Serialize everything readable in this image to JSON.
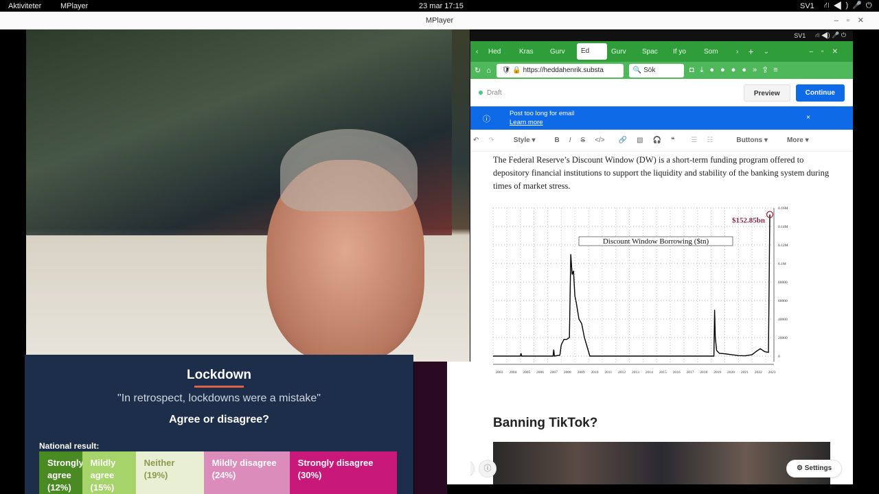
{
  "system": {
    "activities": "Aktiviteter",
    "app": "MPlayer",
    "clock": "23 mar  17:15",
    "lang": "SV1"
  },
  "window": {
    "title": "MPlayer"
  },
  "poll": {
    "title": "Lockdown",
    "quote": "\"In retrospect, lockdowns were a mistake\"",
    "question": "Agree or disagree?",
    "national_label": "National result:",
    "options": [
      {
        "label": "Strongly agree",
        "pct": "(12%)",
        "value": 12,
        "color": "#4a8a22"
      },
      {
        "label": "Mildly agree",
        "pct": "(15%)",
        "value": 15,
        "color": "#a6d46a"
      },
      {
        "label": "Neither",
        "pct": "(19%)",
        "value": 19,
        "color": "#e9efd2"
      },
      {
        "label": "Mildly disagree",
        "pct": "(24%)",
        "value": 24,
        "color": "#dc8cba"
      },
      {
        "label": "Strongly disagree",
        "pct": "(30%)",
        "value": 30,
        "color": "#c8197a"
      }
    ]
  },
  "browser": {
    "tabs": [
      "Hed",
      "Kras",
      "Gurv",
      "Ed",
      "Gurv",
      "Spac",
      "If yo",
      "Som"
    ],
    "active_tab": 3,
    "url": "https://heddahenrik.substa",
    "search_placeholder": "Sök",
    "lang": "SV1"
  },
  "editor": {
    "status": "Draft",
    "preview": "Preview",
    "continue": "Continue",
    "banner_text": "Post too long for email",
    "banner_link": "Learn more",
    "toolbar": {
      "style": "Style",
      "buttons": "Buttons",
      "more": "More"
    },
    "paragraph": "The Federal Reserve’s Discount Window (DW) is a short-term funding program offered to depository financial institutions to support the liquidity and stability of the banking system during times of market stress.",
    "heading": "Banning TikTok?",
    "settings": "Settings",
    "accent": "#0f6ae8"
  },
  "chart_data": {
    "type": "line",
    "title": "Discount Window Borrowing ($tn)",
    "annotation": "$152.85bn",
    "x_ticks": [
      "2003",
      "2004",
      "2005",
      "2006",
      "2007",
      "2008",
      "2009",
      "2010",
      "2011",
      "2012",
      "2013",
      "2014",
      "2015",
      "2016",
      "2017",
      "2018",
      "2019",
      "2020",
      "2021",
      "2022",
      "2023"
    ],
    "y_ticks": [
      "0",
      "20000",
      "40000",
      "60000",
      "80000",
      "0.1M",
      "0.12M",
      "0.14M",
      "0.16M"
    ],
    "ylim": [
      0,
      160000
    ],
    "xlim": [
      2003,
      2023.4
    ],
    "grid": true,
    "x": [
      2003,
      2005,
      2005.05,
      2005.1,
      2007.4,
      2007.45,
      2007.5,
      2007.9,
      2008.0,
      2008.2,
      2008.4,
      2008.6,
      2008.7,
      2008.8,
      2008.9,
      2009.0,
      2009.1,
      2009.3,
      2009.5,
      2009.7,
      2009.9,
      2010.1,
      2010.3,
      2019.2,
      2019.25,
      2019.3,
      2019.4,
      2019.6,
      2020,
      2020.5,
      2021,
      2021.5,
      2022,
      2022.3,
      2022.6,
      2022.9,
      2023.0,
      2023.2,
      2023.3
    ],
    "y": [
      0,
      0,
      3000,
      0,
      0,
      7000,
      0,
      1000,
      12000,
      18000,
      18000,
      20000,
      110000,
      88000,
      92000,
      65000,
      58000,
      40000,
      35000,
      20000,
      10000,
      0,
      0,
      0,
      50000,
      20000,
      6000,
      3000,
      2500,
      1500,
      500,
      300,
      1500,
      5000,
      8000,
      5000,
      4500,
      4000,
      152850
    ]
  }
}
